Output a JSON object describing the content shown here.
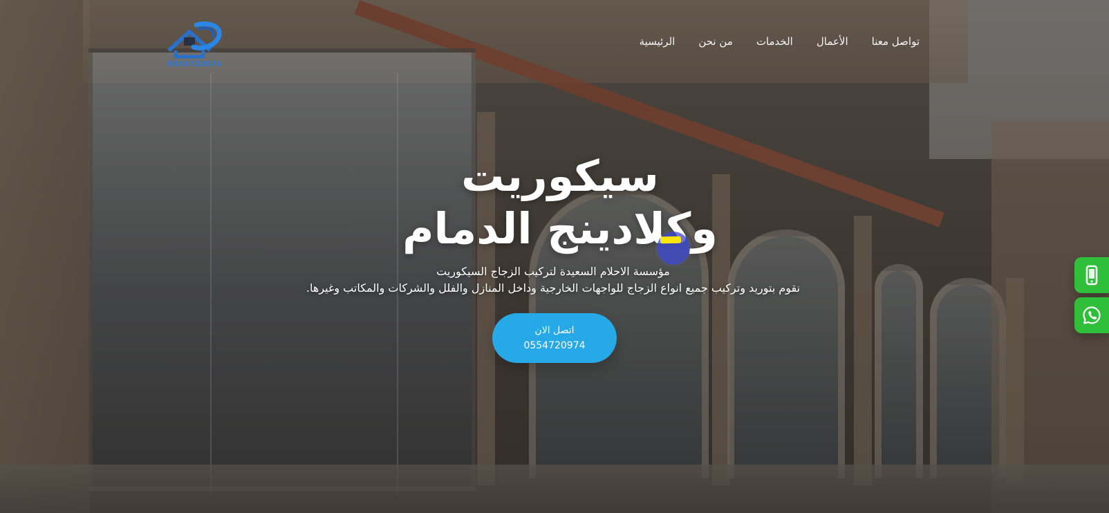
{
  "header": {
    "logo_number": "0554720974",
    "nav": [
      {
        "label": "الرئيسية"
      },
      {
        "label": "من نحن"
      },
      {
        "label": "الخدمات"
      },
      {
        "label": "الأعمال"
      },
      {
        "label": "تواصل معنا"
      }
    ]
  },
  "hero": {
    "title_line1": "سيكوريت",
    "title_line2": "وكلادينج الدمام",
    "subtitle_line1": "مؤسسة الاحلام السعيدة لتركيب الزجاج السيكوريت",
    "subtitle_line2": "نقوم بتوريد وتركيب جميع انواع الزجاج للواجهات الخارجية وداخل المنازل والفلل والشركات والمكاتب وغيرها.",
    "cta_line1": "اتصل الان",
    "cta_line2": "0554720974"
  },
  "floating": {
    "phone_icon": "phone-icon",
    "whatsapp_icon": "whatsapp-icon",
    "color": "#2fbf3a"
  },
  "colors": {
    "accent": "#27a8e7",
    "logo_blue": "#2d77d6",
    "cursor_blue": "#3d49d1",
    "highlight_yellow": "#ffec00"
  }
}
